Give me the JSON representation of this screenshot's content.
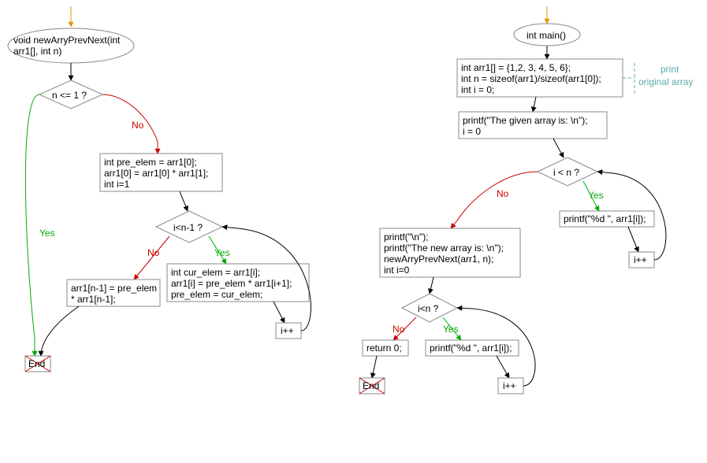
{
  "left": {
    "func_sig_l1": "void newArryPrevNext(int",
    "func_sig_l2": "arr1[], int n)",
    "cond1": "n <= 1 ?",
    "yes1": "Yes",
    "no1": "No",
    "block1_l1": "int pre_elem = arr1[0];",
    "block1_l2": "arr1[0] = arr1[0] * arr1[1];",
    "block1_l3": "int i=1",
    "cond2": "i<n-1 ?",
    "yes2": "Yes",
    "no2": "No",
    "loopbody_l1": "int cur_elem = arr1[i];",
    "loopbody_l2": "arr1[i] = pre_elem * arr1[i+1];",
    "loopbody_l3": "pre_elem = cur_elem;",
    "inc1": "i++",
    "after_l1": "arr1[n-1] = pre_elem",
    "after_l2": "     * arr1[n-1];",
    "end": "End"
  },
  "right": {
    "main_sig": "int main()",
    "decl_l1": "int arr1[] = {1,2, 3, 4, 5, 6};",
    "decl_l2": "int n = sizeof(arr1)/sizeof(arr1[0]);",
    "decl_l3": "int i = 0;",
    "note_l1": "print",
    "note_l2": "original array",
    "print1_l1": "printf(\"The given array is:  \\n\");",
    "print1_l2": "i = 0",
    "cond1": "i < n ?",
    "yes1": "Yes",
    "no1": "No",
    "loop1_body": "printf(\"%d  \", arr1[i]);",
    "inc1": "i++",
    "after1_l1": "printf(\"\\n\");",
    "after1_l2": "printf(\"The new array is: \\n\");",
    "after1_l3": "newArryPrevNext(arr1, n);",
    "after1_l4": "int i=0",
    "cond2": "i<n ?",
    "yes2": "Yes",
    "no2": "No",
    "loop2_body": "printf(\"%d \", arr1[i]);",
    "inc2": "i++",
    "ret": "return 0;",
    "end": "End"
  }
}
